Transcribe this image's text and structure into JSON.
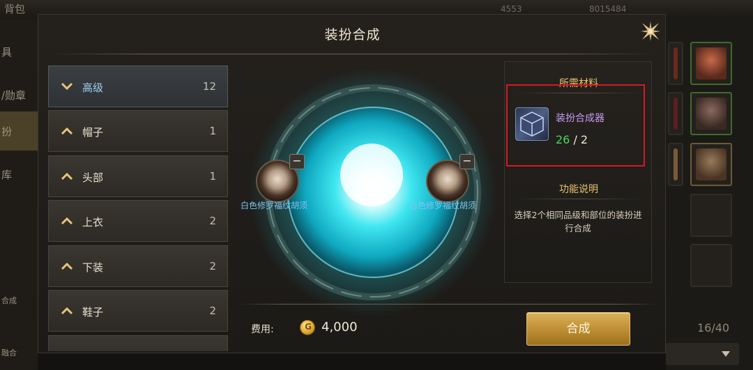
{
  "background": {
    "top_tab": "背包",
    "top_counter": "4553",
    "top_resource": "8015484",
    "left_items": [
      "具",
      "/勋章",
      "扮",
      "库",
      "合成",
      "融合"
    ],
    "slot_count": "16/40"
  },
  "modal": {
    "title": "装扮合成",
    "categories": [
      {
        "label": "高级",
        "count": "12",
        "expanded": true
      },
      {
        "label": "帽子",
        "count": "1",
        "expanded": false
      },
      {
        "label": "头部",
        "count": "1",
        "expanded": false
      },
      {
        "label": "上衣",
        "count": "2",
        "expanded": false
      },
      {
        "label": "下装",
        "count": "2",
        "expanded": false
      },
      {
        "label": "鞋子",
        "count": "2",
        "expanded": false
      }
    ],
    "materials": [
      {
        "name": "白色修罗福纹胡须"
      },
      {
        "name": "白色修罗福纹胡须"
      }
    ],
    "required_title": "所需材料",
    "required_item": {
      "name": "装扮合成器",
      "have": "26",
      "need": "2"
    },
    "function_title": "功能说明",
    "function_desc": "选择2个相同品级和部位的装扮进行合成",
    "fee_label": "费用:",
    "fee_amount": "4,000",
    "synth_button": "合成"
  },
  "colors": {
    "accent_gold": "#e9c26a",
    "material_name": "#7fc4f0",
    "item_purple": "#c79bf0",
    "have_green": "#46d85a",
    "highlight_red": "#d8181e"
  }
}
